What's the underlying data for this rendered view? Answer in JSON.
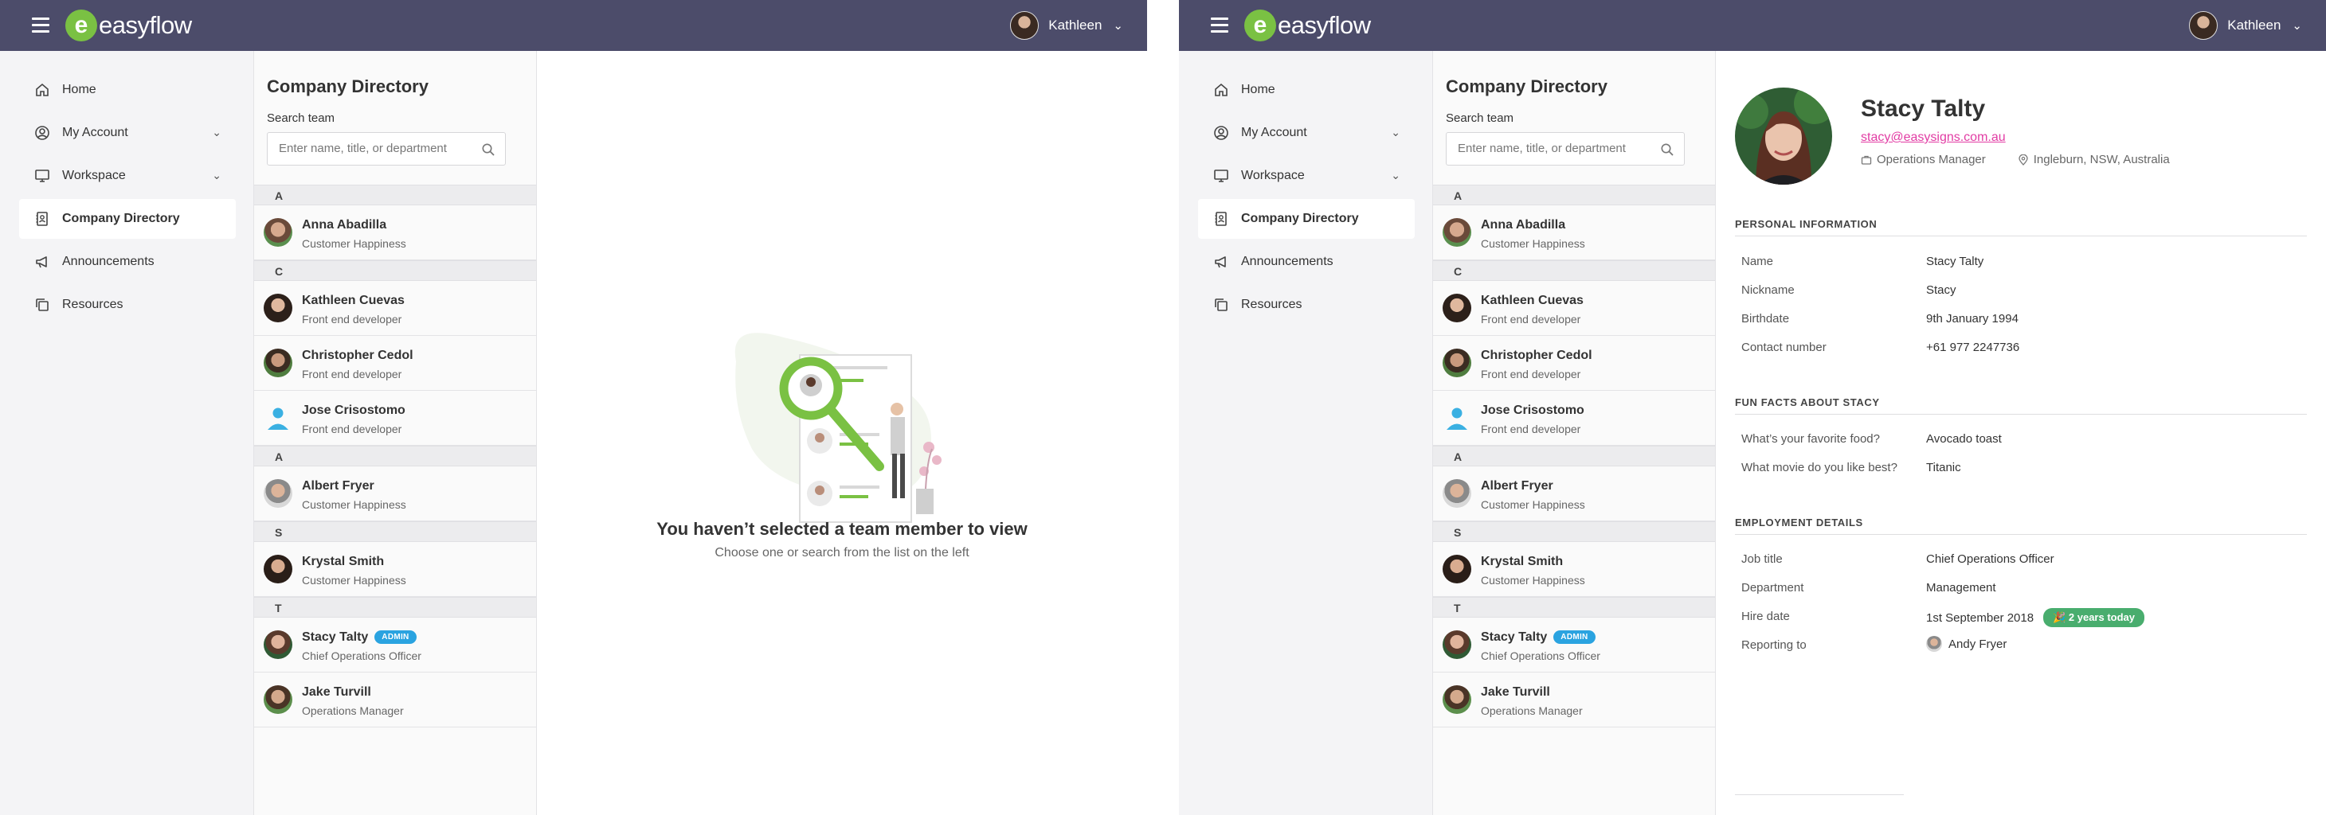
{
  "app": {
    "logo_letter": "e",
    "logo_text": "easyflow",
    "user_name": "Kathleen",
    "colors": {
      "topbar": "#4c4c6a",
      "brand_green": "#7ac143",
      "admin_badge": "#2aa3e0",
      "email_link": "#e23ca4",
      "tenure_badge": "#49ad6e"
    }
  },
  "sidebar": {
    "items": [
      {
        "label": "Home",
        "icon": "home-icon"
      },
      {
        "label": "My Account",
        "icon": "user-circle-icon",
        "has_submenu": true
      },
      {
        "label": "Workspace",
        "icon": "monitor-icon",
        "has_submenu": true
      },
      {
        "label": "Company Directory",
        "icon": "directory-icon",
        "active": true
      },
      {
        "label": "Announcements",
        "icon": "megaphone-icon"
      },
      {
        "label": "Resources",
        "icon": "copy-icon"
      }
    ]
  },
  "directory": {
    "title": "Company Directory",
    "search_label": "Search team",
    "search_placeholder": "Enter name, title, or department",
    "admin_label": "ADMIN",
    "groups": [
      {
        "letter": "A",
        "people": [
          {
            "name": "Anna Abadilla",
            "title": "Customer Happiness",
            "avatar": "woman-green"
          }
        ]
      },
      {
        "letter": "C",
        "people": [
          {
            "name": "Kathleen Cuevas",
            "title": "Front end developer",
            "avatar": "woman-dark"
          },
          {
            "name": "Christopher Cedol",
            "title": "Front end developer",
            "avatar": "man-green"
          },
          {
            "name": "Jose Crisostomo",
            "title": "Front end developer",
            "avatar": "placeholder-blue"
          }
        ]
      },
      {
        "letter": "A",
        "people": [
          {
            "name": "Albert Fryer",
            "title": "Customer Happiness",
            "avatar": "man-grey"
          }
        ]
      },
      {
        "letter": "S",
        "people": [
          {
            "name": "Krystal Smith",
            "title": "Customer Happiness",
            "avatar": "woman-dark"
          }
        ]
      },
      {
        "letter": "T",
        "people": [
          {
            "name": "Stacy Talty",
            "title": "Chief Operations Officer",
            "avatar": "woman-green",
            "admin": true
          },
          {
            "name": "Jake Turvill",
            "title": "Operations Manager",
            "avatar": "man-green"
          }
        ]
      }
    ]
  },
  "empty_state": {
    "title": "You haven’t selected a team member to view",
    "subtitle": "Choose one or search from the list on the left"
  },
  "profile": {
    "name": "Stacy Talty",
    "email": "stacy@easysigns.com.au",
    "role": "Operations Manager",
    "location": "Ingleburn, NSW, Australia",
    "sections": {
      "personal": {
        "title": "PERSONAL INFORMATION",
        "rows": [
          {
            "key": "Name",
            "value": "Stacy Talty"
          },
          {
            "key": "Nickname",
            "value": "Stacy"
          },
          {
            "key": "Birthdate",
            "value": "9th January 1994"
          },
          {
            "key": "Contact number",
            "value": "+61 977 2247736"
          }
        ]
      },
      "fun": {
        "title": "FUN FACTS ABOUT STACY",
        "rows": [
          {
            "key": "What’s your favorite food?",
            "value": "Avocado toast"
          },
          {
            "key": "What movie do you like best?",
            "value": "Titanic"
          }
        ]
      },
      "employment": {
        "title": "EMPLOYMENT DETAILS",
        "rows": [
          {
            "key": "Job title",
            "value": "Chief Operations Officer"
          },
          {
            "key": "Department",
            "value": "Management"
          },
          {
            "key": "Hire date",
            "value": "1st September 2018"
          },
          {
            "key": "Reporting to",
            "value": "Andy Fryer"
          }
        ],
        "tenure": "🎉 2 years today"
      }
    }
  }
}
